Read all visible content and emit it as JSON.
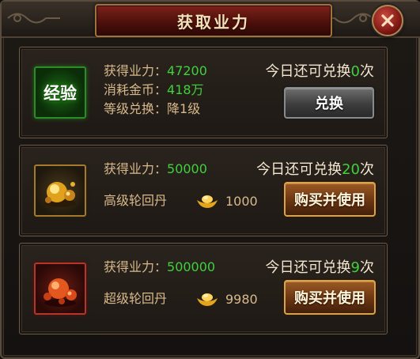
{
  "window": {
    "title": "获取业力",
    "close_icon": "close-x-icon"
  },
  "colors": {
    "label": "#d8b98c",
    "value_green": "#3fd13c",
    "title_plate": "#7c2219",
    "button_gold_border": "#d6a34f"
  },
  "rows": [
    {
      "item_label": "经验",
      "item_icon": "experience-badge-icon",
      "gain_label": "获得业力：",
      "gain_value": "47200",
      "cost_label": "消耗金币：",
      "cost_value": "418万",
      "level_label": "等级兑换：",
      "level_value": "降1级",
      "remain_prefix": "今日还可兑换",
      "remain_count": "0",
      "remain_suffix": "次",
      "button_label": "兑换"
    },
    {
      "item_icon": "gold-reincarnation-pill-icon",
      "gain_label": "获得业力：",
      "gain_value": "50000",
      "item_name": "高级轮回丹",
      "price_icon": "gold-ingot-icon",
      "price_value": "1000",
      "remain_prefix": "今日还可兑换",
      "remain_count": "20",
      "remain_suffix": "次",
      "button_label": "购买并使用"
    },
    {
      "item_icon": "red-reincarnation-pill-icon",
      "gain_label": "获得业力：",
      "gain_value": "500000",
      "item_name": "超级轮回丹",
      "price_icon": "gold-ingot-icon",
      "price_value": "9980",
      "remain_prefix": "今日还可兑换",
      "remain_count": "9",
      "remain_suffix": "次",
      "button_label": "购买并使用"
    }
  ]
}
